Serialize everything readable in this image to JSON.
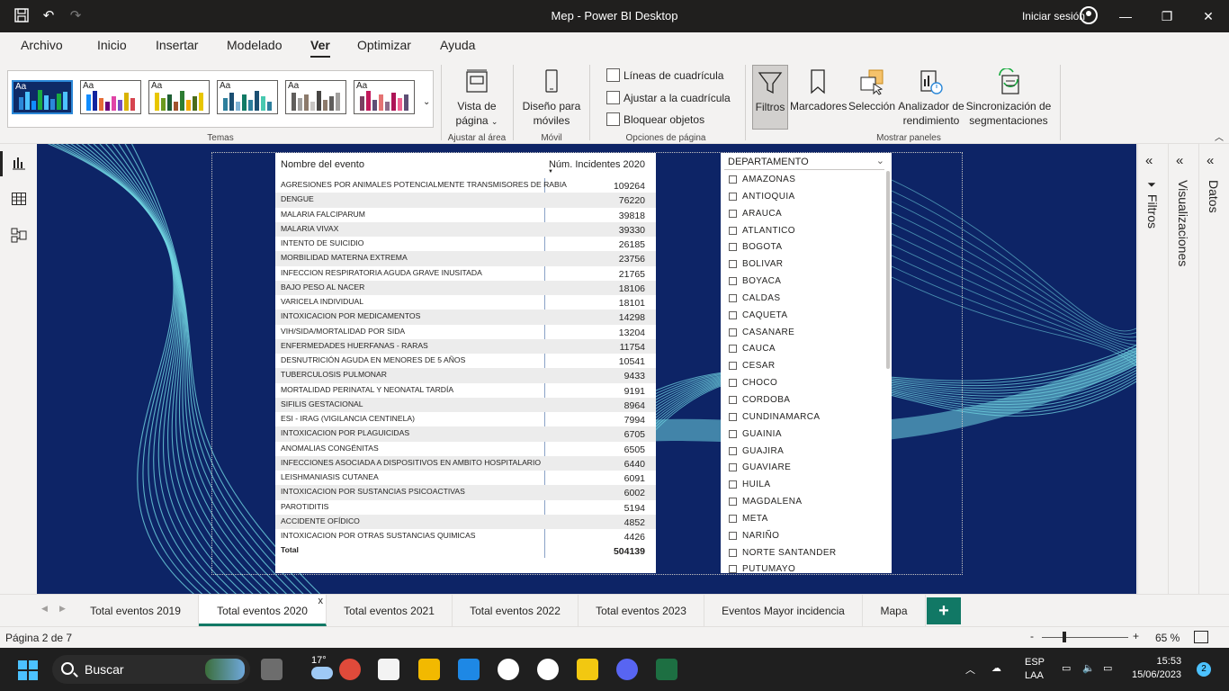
{
  "window": {
    "title": "Mep - Power BI Desktop",
    "sign_in": "Iniciar sesión"
  },
  "menu": {
    "tabs": [
      "Archivo",
      "Inicio",
      "Insertar",
      "Modelado",
      "Ver",
      "Optimizar",
      "Ayuda"
    ],
    "active": "Ver"
  },
  "ribbon": {
    "themes_label": "Temas",
    "theme_aa": "Aa",
    "page_view": "Vista de",
    "page_view2": "página",
    "fit_area_label": "Ajustar al área",
    "mobile_layout": "Diseño para",
    "mobile_layout2": "móviles",
    "mobile_label": "Móvil",
    "gridlines": "Líneas de cuadrícula",
    "snap_grid": "Ajustar a la cuadrícula",
    "lock_objects": "Bloquear objetos",
    "page_options_label": "Opciones de página",
    "filters": "Filtros",
    "bookmarks": "Marcadores",
    "selection": "Selección",
    "perf_analyzer": "Analizador de",
    "perf_analyzer2": "rendimiento",
    "sync_slicers": "Sincronización de",
    "sync_slicers2": "segmentaciones",
    "show_panes_label": "Mostrar paneles"
  },
  "table": {
    "col_name": "Nombre del evento",
    "col_value": "Núm. Incidentes 2020",
    "rows": [
      [
        "AGRESIONES POR ANIMALES POTENCIALMENTE TRANSMISORES DE RABIA",
        "109264"
      ],
      [
        "DENGUE",
        "76220"
      ],
      [
        "MALARIA FALCIPARUM",
        "39818"
      ],
      [
        "MALARIA VIVAX",
        "39330"
      ],
      [
        "INTENTO DE SUICIDIO",
        "26185"
      ],
      [
        "MORBILIDAD MATERNA EXTREMA",
        "23756"
      ],
      [
        "INFECCION RESPIRATORIA AGUDA GRAVE INUSITADA",
        "21765"
      ],
      [
        "BAJO PESO AL NACER",
        "18106"
      ],
      [
        "VARICELA INDIVIDUAL",
        "18101"
      ],
      [
        "INTOXICACION POR MEDICAMENTOS",
        "14298"
      ],
      [
        "VIH/SIDA/MORTALIDAD POR SIDA",
        "13204"
      ],
      [
        "ENFERMEDADES HUERFANAS - RARAS",
        "11754"
      ],
      [
        "DESNUTRICIÓN AGUDA EN MENORES DE 5 AÑOS",
        "10541"
      ],
      [
        "TUBERCULOSIS PULMONAR",
        "9433"
      ],
      [
        "MORTALIDAD PERINATAL Y NEONATAL TARDÍA",
        "9191"
      ],
      [
        "SIFILIS GESTACIONAL",
        "8964"
      ],
      [
        "ESI - IRAG (VIGILANCIA CENTINELA)",
        "7994"
      ],
      [
        "INTOXICACION POR PLAGUICIDAS",
        "6705"
      ],
      [
        "ANOMALIAS CONGÉNITAS",
        "6505"
      ],
      [
        "INFECCIONES ASOCIADA A DISPOSITIVOS EN AMBITO HOSPITALARIO",
        "6440"
      ],
      [
        "LEISHMANIASIS CUTANEA",
        "6091"
      ],
      [
        "INTOXICACION POR SUSTANCIAS PSICOACTIVAS",
        "6002"
      ],
      [
        "PAROTIDITIS",
        "5194"
      ],
      [
        "ACCIDENTE OFÍDICO",
        "4852"
      ],
      [
        "INTOXICACION POR OTRAS SUSTANCIAS QUIMICAS",
        "4426"
      ]
    ],
    "total_label": "Total",
    "total_value": "504139"
  },
  "slicer": {
    "title": "DEPARTAMENTO",
    "items": [
      "AMAZONAS",
      "ANTIOQUIA",
      "ARAUCA",
      "ATLANTICO",
      "BOGOTA",
      "BOLIVAR",
      "BOYACA",
      "CALDAS",
      "CAQUETA",
      "CASANARE",
      "CAUCA",
      "CESAR",
      "CHOCO",
      "CORDOBA",
      "CUNDINAMARCA",
      "GUAINIA",
      "GUAJIRA",
      "GUAVIARE",
      "HUILA",
      "MAGDALENA",
      "META",
      "NARIÑO",
      "NORTE SANTANDER",
      "PUTUMAYO"
    ]
  },
  "panes": {
    "filters": "Filtros",
    "visualizations": "Visualizaciones",
    "data": "Datos"
  },
  "page_tabs": {
    "tabs": [
      "Total eventos 2019",
      "Total eventos 2020",
      "Total eventos 2021",
      "Total eventos 2022",
      "Total eventos 2023",
      "Eventos Mayor incidencia",
      "Mapa"
    ],
    "active_index": 1,
    "add": "+",
    "close": "x"
  },
  "status": {
    "page_info": "Página 2 de 7",
    "zoom_minus": "-",
    "zoom_plus": "+",
    "zoom_level": "65 %",
    "zoom_fraction": 0.24
  },
  "taskbar": {
    "search": "Buscar",
    "temperature": "17°",
    "lang1": "ESP",
    "lang2": "LAA",
    "time": "15:53",
    "date": "15/06/2023",
    "notifications": "2"
  },
  "colors": {
    "canvas_bg": "#0d2466",
    "wave": "#6fd3e0",
    "accent_teal": "#117865"
  }
}
